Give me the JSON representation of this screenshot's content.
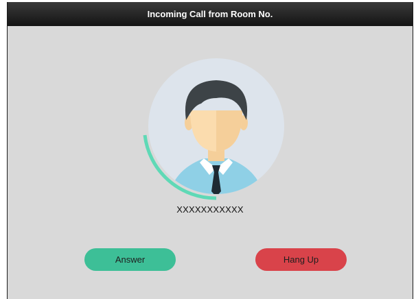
{
  "window": {
    "title": "Incoming Call from Room No."
  },
  "caller": {
    "id": "XXXXXXXXXXX"
  },
  "actions": {
    "answer_label": "Answer",
    "hangup_label": "Hang Up"
  },
  "colors": {
    "answer": "#3dbf97",
    "hangup": "#d9434a",
    "ring_progress": "#5fd9b6",
    "avatar_bg": "#dde4ec"
  },
  "icons": {
    "caller": "user-avatar-icon"
  }
}
